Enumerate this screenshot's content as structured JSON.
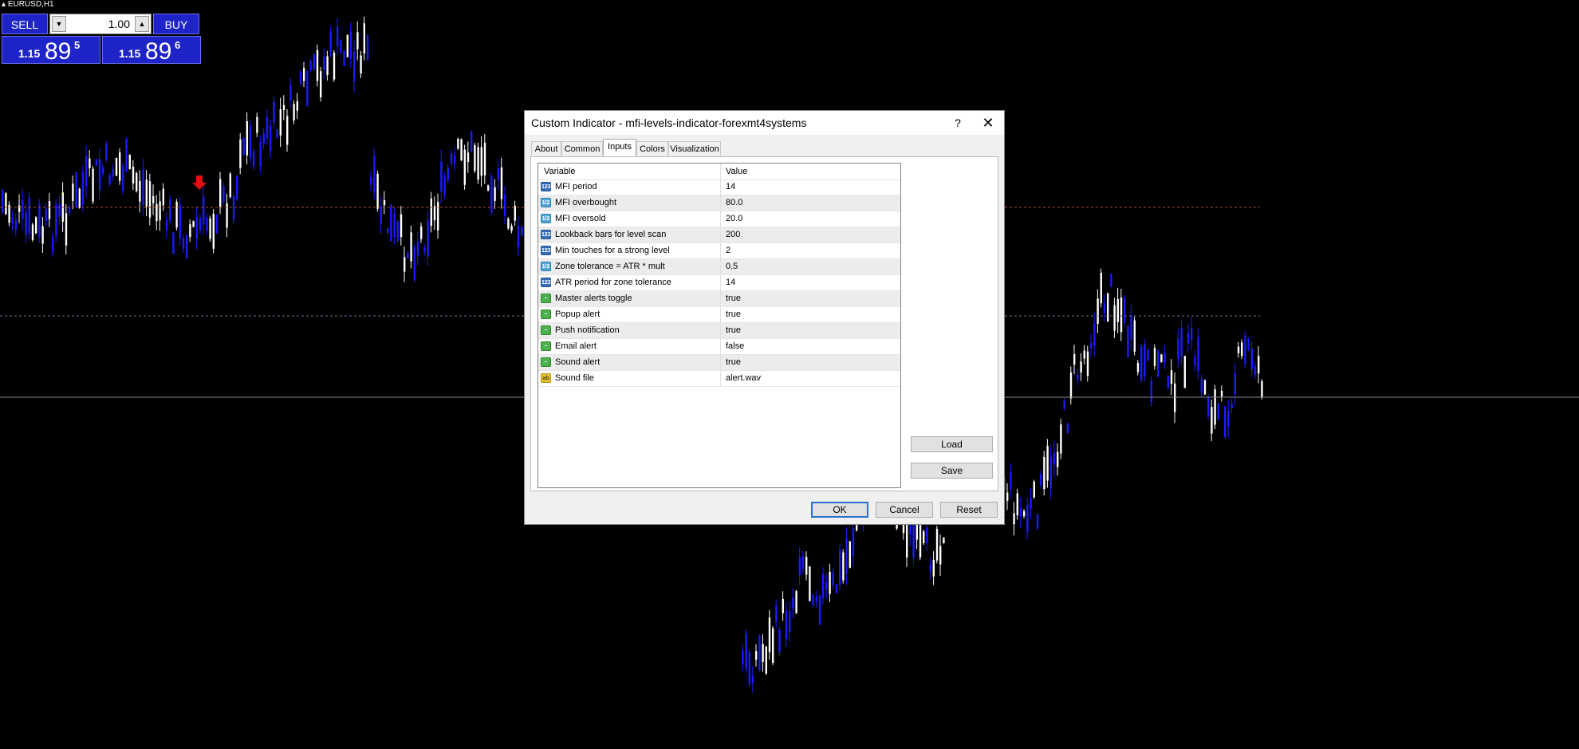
{
  "chart": {
    "symbol": "EURUSD,H1",
    "colors": {
      "background": "#000000",
      "bull": "#ffffff",
      "bear": "#1a1aff",
      "level_dashed": "#b04a2a",
      "level_dashed_2": "#6a6f90",
      "price_line": "#8a8a8a",
      "arrow": "#e01010"
    }
  },
  "trade_panel": {
    "sell_label": "SELL",
    "buy_label": "BUY",
    "lot_value": "1.00",
    "lot_down_icon": "triangle-down-icon",
    "lot_up_icon": "triangle-up-icon",
    "sell_price": {
      "prefix": "1.15",
      "big": "89",
      "sup": "5"
    },
    "buy_price": {
      "prefix": "1.15",
      "big": "89",
      "sup": "6"
    }
  },
  "dialog": {
    "title": "Custom Indicator - mfi-levels-indicator-forexmt4systems",
    "help_label": "?",
    "close_label": "✕",
    "tabs": [
      "About",
      "Common",
      "Inputs",
      "Colors",
      "Visualization"
    ],
    "active_tab": "Inputs",
    "grid": {
      "headers": {
        "variable": "Variable",
        "value": "Value"
      },
      "rows": [
        {
          "type": "int",
          "type_label": "123",
          "name": "MFI period",
          "value": "14"
        },
        {
          "type": "dbl",
          "type_label": "1/2",
          "name": "MFI overbought",
          "value": "80.0"
        },
        {
          "type": "dbl",
          "type_label": "1/2",
          "name": "MFI oversold",
          "value": "20.0"
        },
        {
          "type": "int",
          "type_label": "123",
          "name": "Lookback bars for level scan",
          "value": "200"
        },
        {
          "type": "int",
          "type_label": "123",
          "name": "Min touches for a strong level",
          "value": "2"
        },
        {
          "type": "dbl",
          "type_label": "1/2",
          "name": "Zone tolerance = ATR * mult",
          "value": "0.5"
        },
        {
          "type": "int",
          "type_label": "123",
          "name": "ATR period for zone tolerance",
          "value": "14"
        },
        {
          "type": "bool",
          "type_label": "~",
          "name": "Master alerts toggle",
          "value": "true"
        },
        {
          "type": "bool",
          "type_label": "~",
          "name": "Popup alert",
          "value": "true"
        },
        {
          "type": "bool",
          "type_label": "~",
          "name": "Push notification",
          "value": "true"
        },
        {
          "type": "bool",
          "type_label": "~",
          "name": "Email alert",
          "value": "false"
        },
        {
          "type": "bool",
          "type_label": "~",
          "name": "Sound alert",
          "value": "true"
        },
        {
          "type": "str",
          "type_label": "ab",
          "name": "Sound file",
          "value": "alert.wav"
        }
      ]
    },
    "buttons": {
      "load": "Load",
      "save": "Save",
      "ok": "OK",
      "cancel": "Cancel",
      "reset": "Reset"
    }
  }
}
